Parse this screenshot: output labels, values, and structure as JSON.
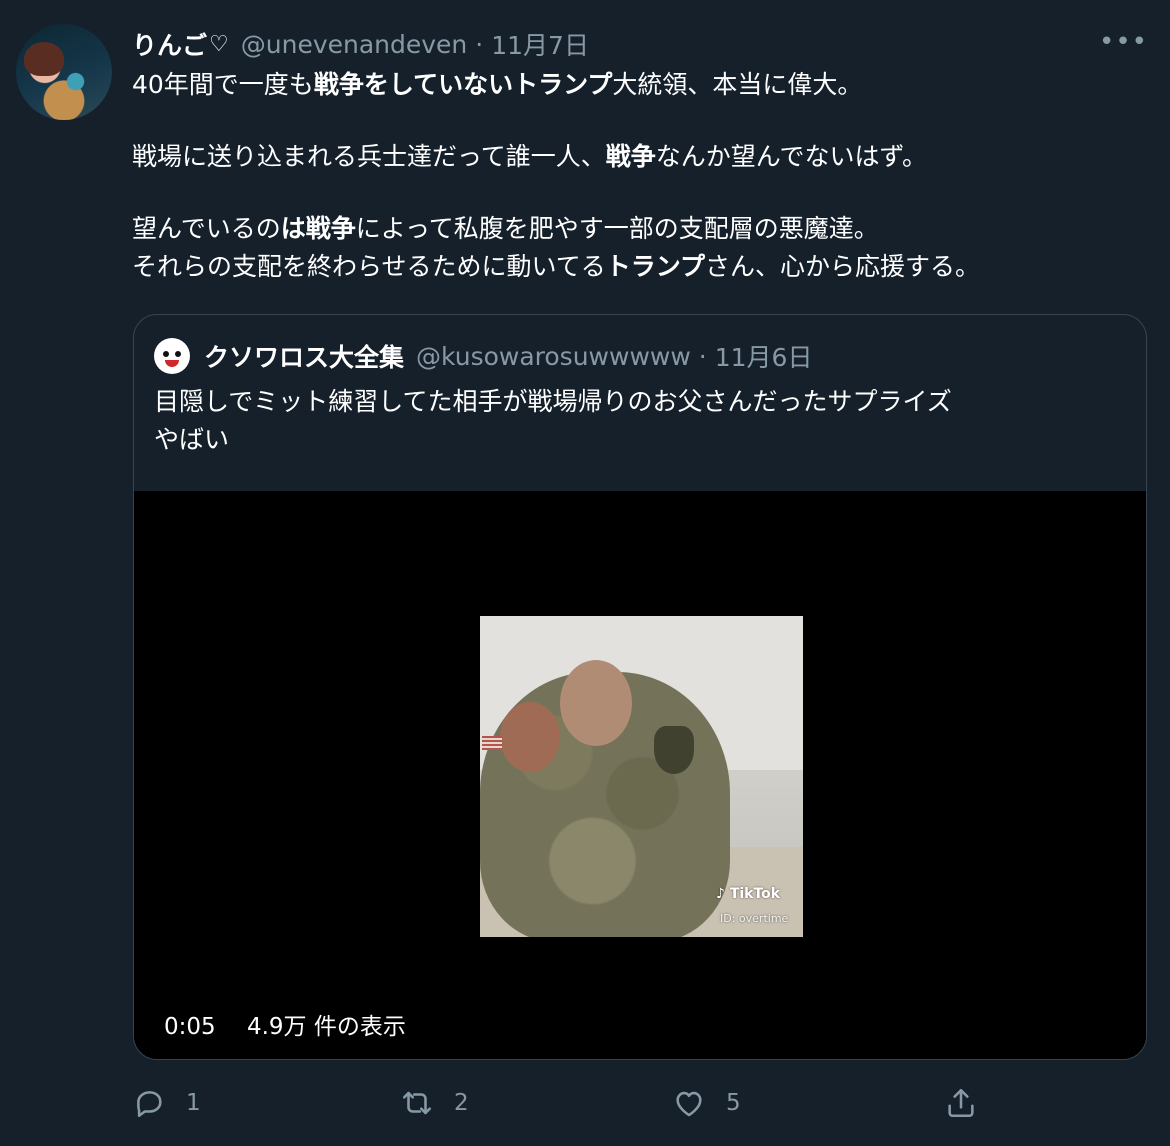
{
  "tweet": {
    "display_name": "りんご",
    "name_heart": "♡",
    "handle": "@unevenandeven",
    "separator": "·",
    "date": "11月7日",
    "more_label": "•••",
    "lines": [
      {
        "t1": "40年間で一度も",
        "b1": "戦争をしていないトランプ",
        "t2": "大統領、本当に偉大。"
      },
      {
        "t1": "戦場に送り込まれる兵士達だって誰一人、",
        "b1": "戦争",
        "t2": "なんか望んでないはず。"
      },
      {
        "t1": "望んでいるの",
        "b1": "は戦争",
        "t2": "によって私腹を肥やす一部の支配層の悪魔達。"
      },
      {
        "t1": "それらの支配を終わらせるために動いてる",
        "b1": "トランプ",
        "t2": "さん、心から応援する。"
      }
    ]
  },
  "quote": {
    "display_name": "クソワロス大全集",
    "handle": "@kusowarosuwwwww",
    "separator": "·",
    "date": "11月6日",
    "text_line1": "目隠しでミット練習してた相手が戦場帰りのお父さんだったサプライズ",
    "text_line2": "やばい",
    "video": {
      "duration": "0:05",
      "views": "4.9万 件の表示",
      "watermark": "TikTok",
      "watermark_user": "overtime"
    }
  },
  "actions": {
    "reply_count": "1",
    "retweet_count": "2",
    "like_count": "5"
  },
  "icons": [
    "reply-icon",
    "retweet-icon",
    "like-icon",
    "share-icon",
    "more-icon"
  ],
  "colors": {
    "background": "#15202b",
    "secondary_text": "#8899a6",
    "border": "#38444d"
  }
}
